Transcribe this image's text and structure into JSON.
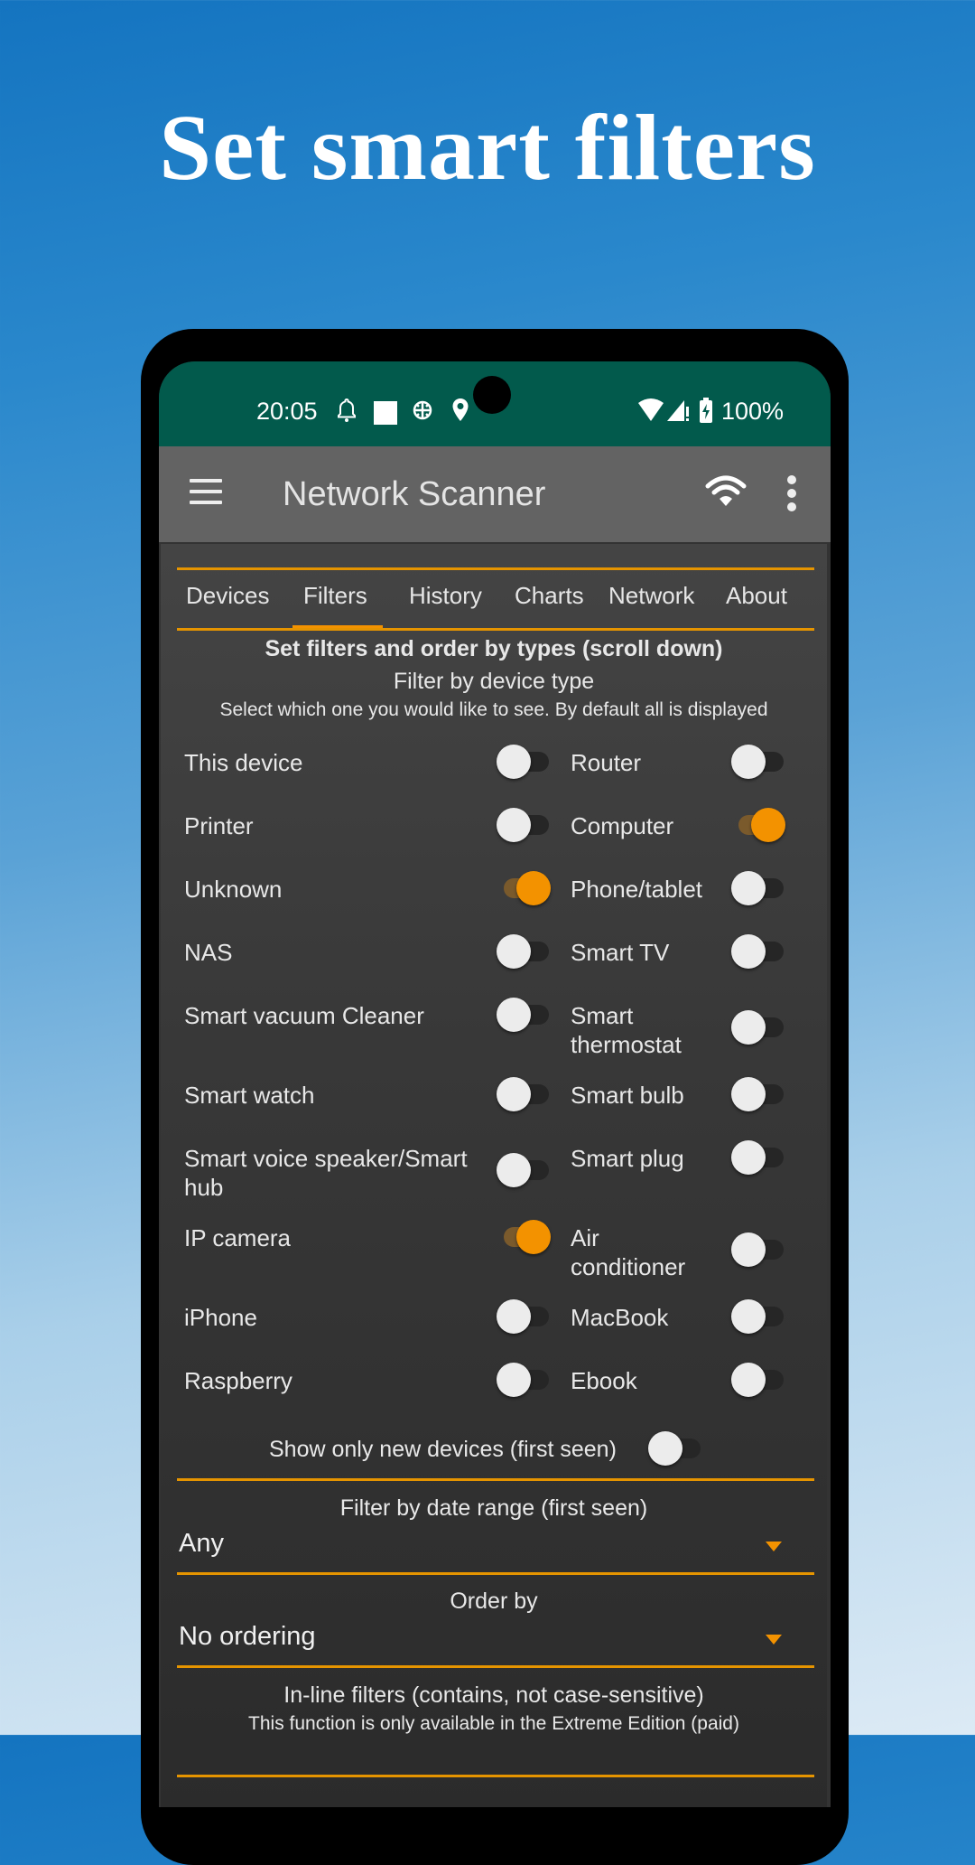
{
  "headline": "Set smart filters",
  "status_bar": {
    "time": "20:05",
    "left_icons": [
      "bell-icon",
      "square-icon",
      "bug-icon",
      "location-icon"
    ],
    "right_icons": [
      "wifi-icon",
      "signal-icon",
      "battery-charging-icon"
    ],
    "battery": "100%"
  },
  "app_bar": {
    "title": "Network Scanner",
    "actions": [
      "menu-icon",
      "wifi-scan-icon",
      "more-vert-icon"
    ]
  },
  "tabs": [
    {
      "label": "Devices",
      "active": false
    },
    {
      "label": "Filters",
      "active": true
    },
    {
      "label": "History",
      "active": false
    },
    {
      "label": "Charts",
      "active": false
    },
    {
      "label": "Network",
      "active": false
    },
    {
      "label": "About",
      "active": false
    }
  ],
  "filters": {
    "heading": "Set filters and order by types (scroll down)",
    "subheading": "Filter by device type",
    "description": "Select which one you would like to see. By default all is displayed",
    "device_types": [
      {
        "label": "This device",
        "on": false
      },
      {
        "label": "Router",
        "on": false
      },
      {
        "label": "Printer",
        "on": false
      },
      {
        "label": "Computer",
        "on": true
      },
      {
        "label": "Unknown",
        "on": true
      },
      {
        "label": "Phone/tablet",
        "on": false
      },
      {
        "label": "NAS",
        "on": false
      },
      {
        "label": "Smart TV",
        "on": false
      },
      {
        "label": "Smart vacuum Cleaner",
        "on": false
      },
      {
        "label": "Smart thermostat",
        "on": false
      },
      {
        "label": "Smart watch",
        "on": false
      },
      {
        "label": "Smart bulb",
        "on": false
      },
      {
        "label": "Smart voice speaker/Smart hub",
        "on": false
      },
      {
        "label": "Smart plug",
        "on": false
      },
      {
        "label": "IP camera",
        "on": true
      },
      {
        "label": "Air conditioner",
        "on": false
      },
      {
        "label": "iPhone",
        "on": false
      },
      {
        "label": "MacBook",
        "on": false
      },
      {
        "label": "Raspberry",
        "on": false
      },
      {
        "label": "Ebook",
        "on": false
      }
    ],
    "new_devices": {
      "label": "Show only new devices (first seen)",
      "on": false
    },
    "date_range": {
      "label": "Filter by date range (first seen)",
      "value": "Any"
    },
    "order_by": {
      "label": "Order by",
      "value": "No ordering"
    },
    "inline_filters": {
      "label": "In-line filters (contains, not case-sensitive)",
      "note": "This function is only available in the Extreme Edition (paid)"
    }
  },
  "colors": {
    "accent": "#f39200",
    "status_bar": "#025a4c",
    "app_bar": "#636363",
    "background": "#333333"
  }
}
